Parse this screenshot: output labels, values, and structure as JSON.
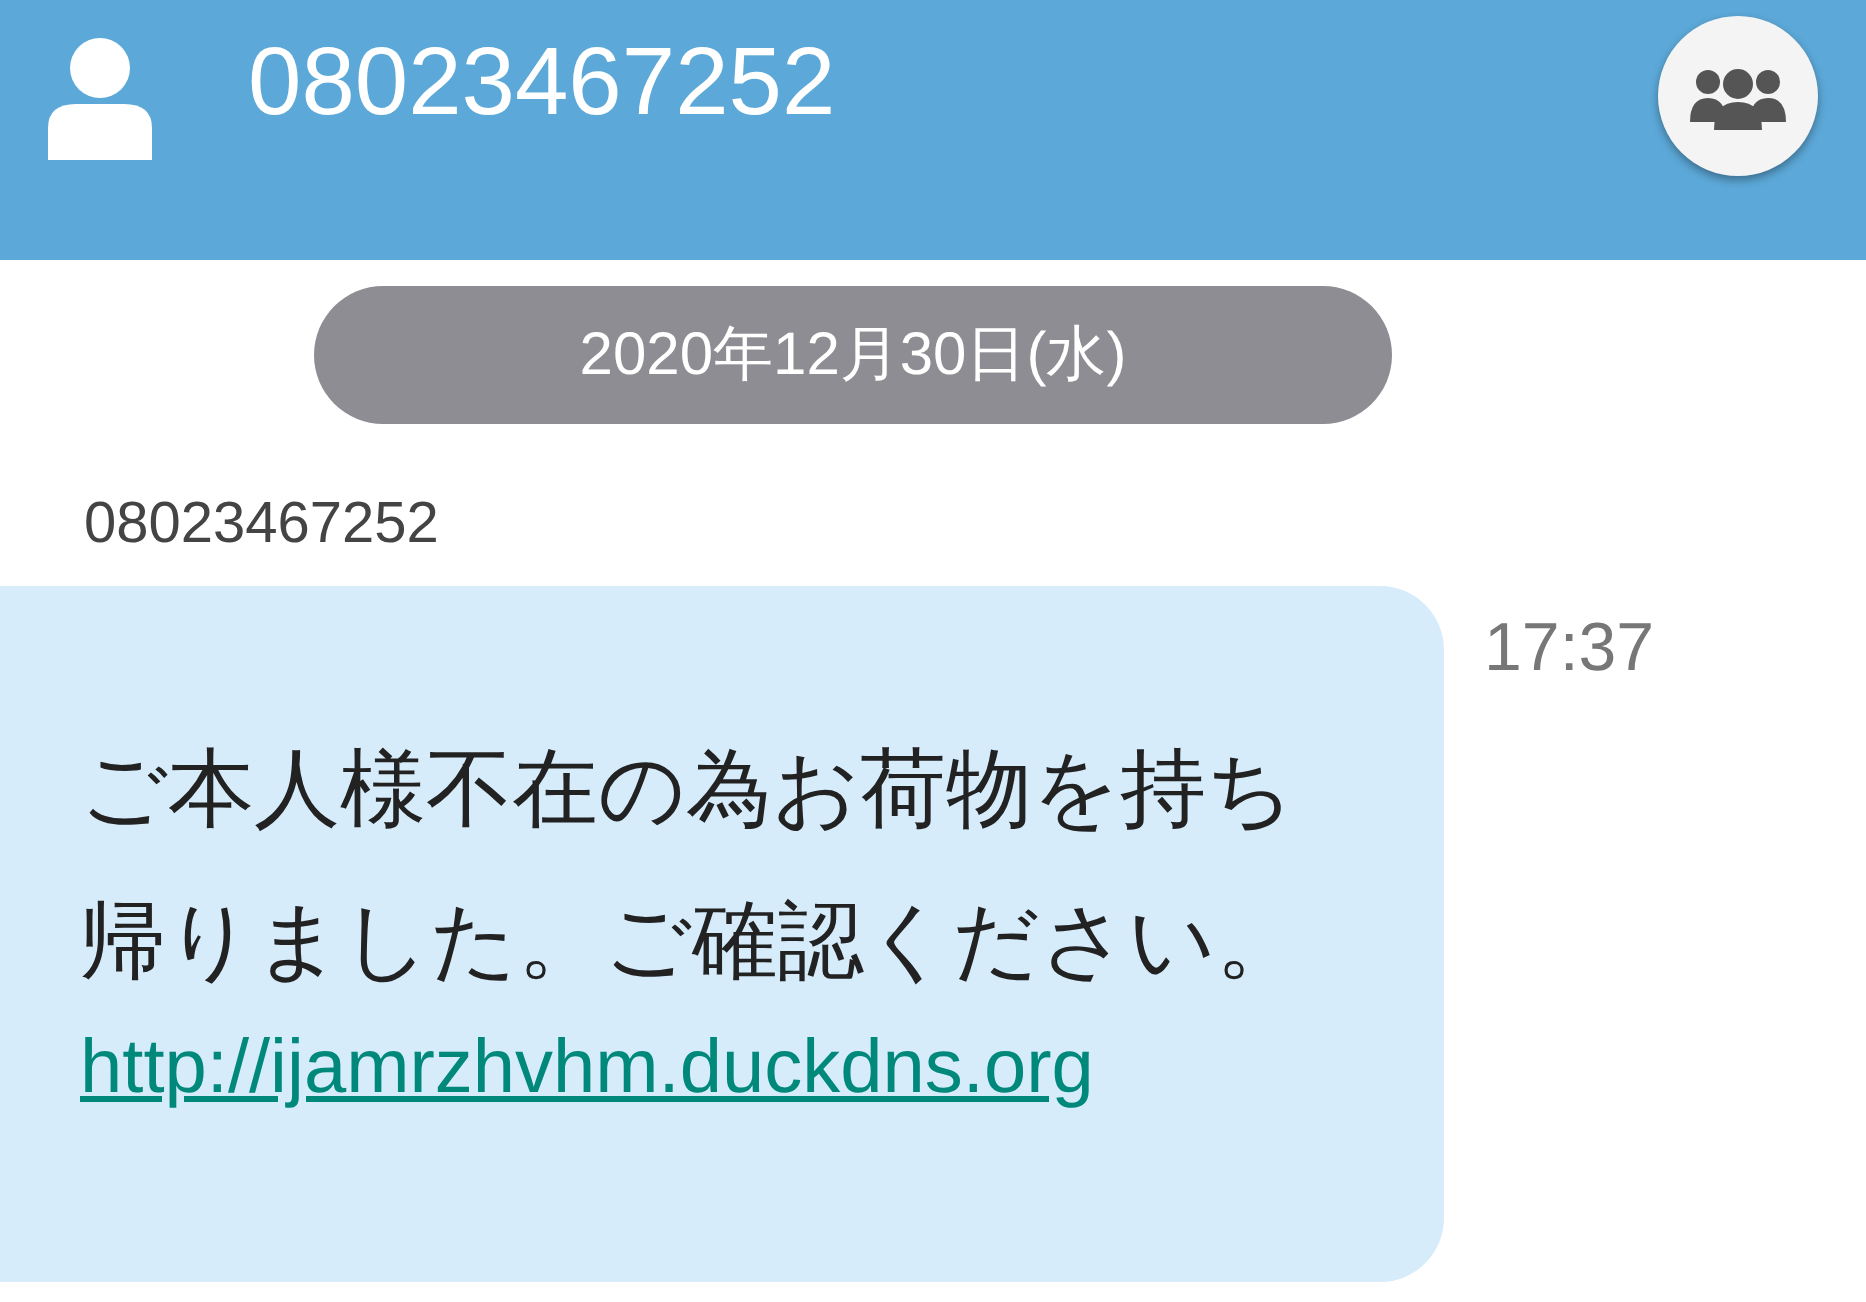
{
  "header": {
    "title": "08023467252"
  },
  "date_separator": "2020年12月30日(水)",
  "messages": [
    {
      "sender": "08023467252",
      "text": "ご本人様不在の為お荷物を持ち帰りました。ご確認ください。",
      "link": "http://ijamrzhvhm.duckdns.org",
      "time": "17:37"
    }
  ]
}
